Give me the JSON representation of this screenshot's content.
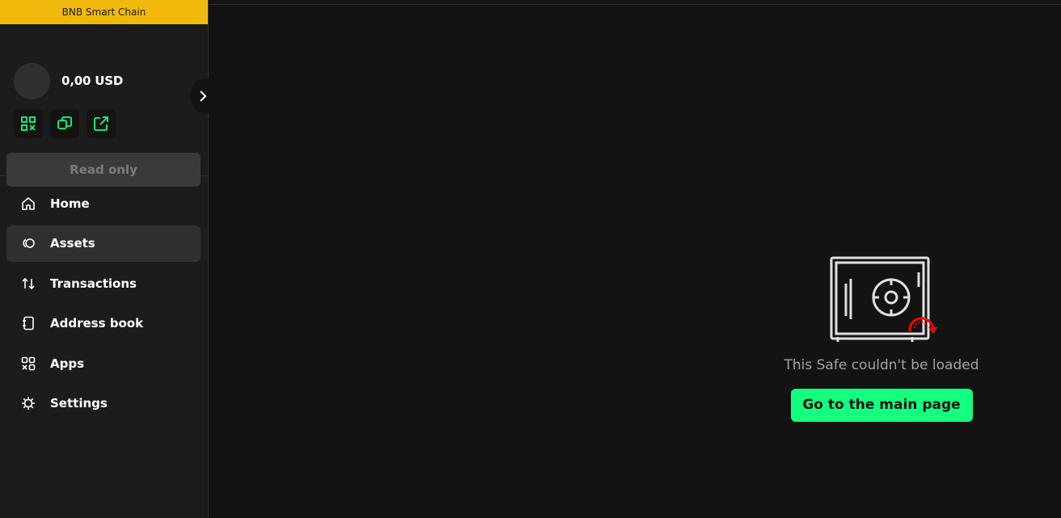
{
  "chain": {
    "name": "BNB Smart Chain"
  },
  "safe": {
    "balance": "0,00 USD"
  },
  "sidebar": {
    "toggle_icon": "chevron-right-icon",
    "actions": [
      {
        "icon": "qr-code-icon"
      },
      {
        "icon": "copy-icon"
      },
      {
        "icon": "external-link-icon"
      }
    ],
    "read_only_label": "Read only",
    "nav_items": [
      {
        "label": "Home",
        "icon": "home-icon"
      },
      {
        "label": "Assets",
        "icon": "assets-icon",
        "active": true
      },
      {
        "label": "Transactions",
        "icon": "transactions-icon"
      },
      {
        "label": "Address book",
        "icon": "address-book-icon"
      },
      {
        "label": "Apps",
        "icon": "apps-icon"
      },
      {
        "label": "Settings",
        "icon": "settings-icon"
      }
    ]
  },
  "main": {
    "error_text": "This Safe couldn't be loaded",
    "button_label": "Go to the main page"
  },
  "colors": {
    "accent": "#12ff80",
    "chain_bar": "#f0b90b",
    "error_icon": "#ff0000",
    "background": "#121312",
    "sidebar": "#1c1c1c"
  }
}
